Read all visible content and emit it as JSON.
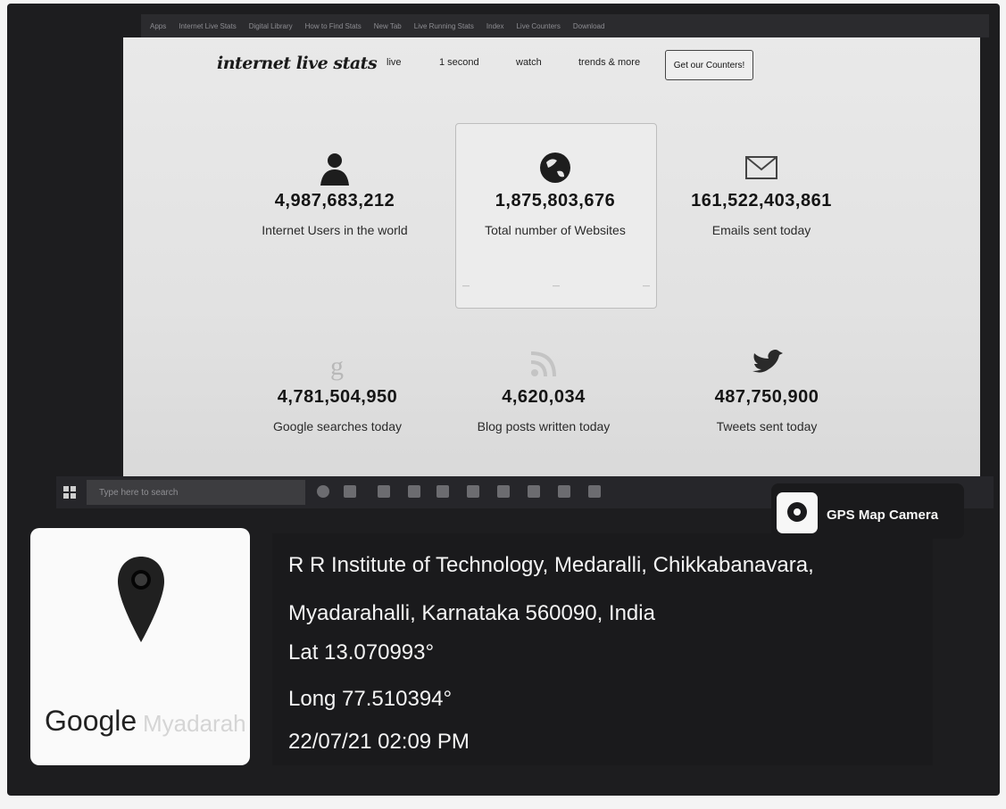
{
  "browser": {
    "tabs": [
      "Apps",
      "Internet Live Stats",
      "Digital Library",
      "How to Find Stats",
      "New Tab",
      "Live Running Stats",
      "Index",
      "Live Counters",
      "Download"
    ]
  },
  "site": {
    "logo": "internet live stats",
    "nav": {
      "live": "live",
      "one_second": "1 second",
      "watch": "watch",
      "trends": "trends & more",
      "counters_button": "Get our Counters!"
    }
  },
  "stats": [
    {
      "value": "4,987,683,212",
      "label": "Internet Users in the world",
      "icon": "user-icon"
    },
    {
      "value": "1,875,803,676",
      "label": "Total number of Websites",
      "icon": "globe-icon"
    },
    {
      "value": "161,522,403,861",
      "label": "Emails sent today",
      "icon": "envelope-icon"
    },
    {
      "value": "4,781,504,950",
      "label": "Google searches today",
      "icon": "google-icon"
    },
    {
      "value": "4,620,034",
      "label": "Blog posts written today",
      "icon": "rss-icon"
    },
    {
      "value": "487,750,900",
      "label": "Tweets sent today",
      "icon": "twitter-bird-icon"
    }
  ],
  "taskbar": {
    "search_placeholder": "Type here to search"
  },
  "gps_overlay": {
    "app_name": "GPS Map Camera",
    "map_provider": "Google",
    "map_place_fragment": "Myadarah",
    "address_line1": "R R Institute of Technology, Medaralli, Chikkabanavara,",
    "address_line2": "Myadarahalli, Karnataka 560090, India",
    "latitude": "Lat 13.070993°",
    "longitude": "Long 77.510394°",
    "datetime": "22/07/21 02:09 PM"
  },
  "colors": {
    "overlay_bg": "#1a1a1c",
    "screen_bg": "#e6e6e6",
    "taskbar_bg": "#26262a"
  }
}
